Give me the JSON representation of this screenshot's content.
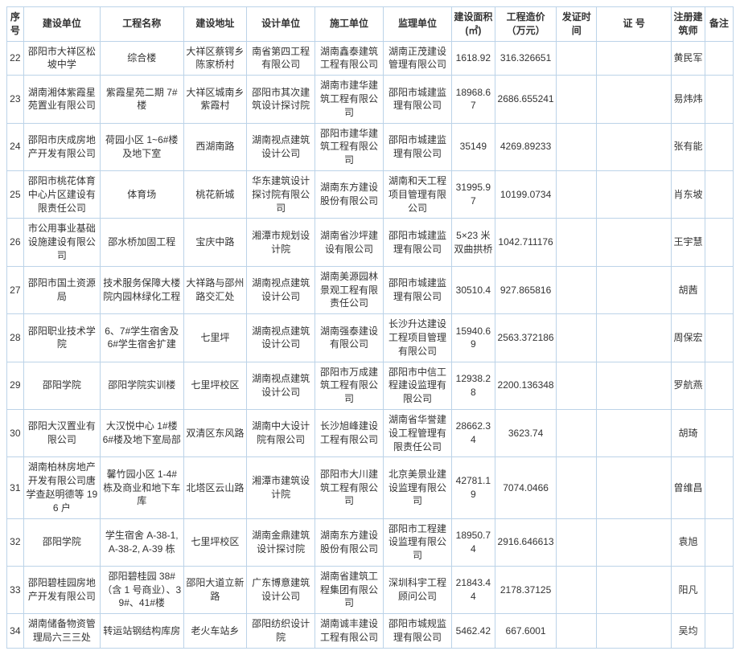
{
  "headers": {
    "seq": "序号",
    "unit": "建设单位",
    "proj": "工程名称",
    "addr": "建设地址",
    "designer": "设计单位",
    "contractor": "施工单位",
    "supervisor": "监理单位",
    "area": "建设面积(㎡)",
    "cost": "工程造价（万元）",
    "date": "发证时间",
    "cert": "证   号",
    "architect": "注册建筑师",
    "note": "备注"
  },
  "rows": [
    {
      "seq": "22",
      "unit": "邵阳市大祥区松坡中学",
      "proj": "综合楼",
      "addr": "大祥区蔡锷乡陈家桥村",
      "designer": "南省第四工程有限公司",
      "contractor": "湖南鑫泰建筑工程有限公司",
      "supervisor": "湖南正茂建设管理有限公司",
      "area": "1618.92",
      "cost": "316.326651",
      "date": "",
      "cert": "",
      "architect": "黄民军",
      "note": ""
    },
    {
      "seq": "23",
      "unit": "湖南湘体紫霞星苑置业有限公司",
      "proj": "紫霞星苑二期 7#楼",
      "addr": "大祥区城南乡紫霞村",
      "designer": "邵阳市其次建筑设计探讨院",
      "contractor": "湖南市建华建筑工程有限公司",
      "supervisor": "邵阳市城建监理有限公司",
      "area": "18968.67",
      "cost": "2686.655241",
      "date": "",
      "cert": "",
      "architect": "易炜炜",
      "note": ""
    },
    {
      "seq": "24",
      "unit": "邵阳市庆成房地产开发有限公司",
      "proj": "荷园小区 1~6#楼及地下室",
      "addr": "西湖南路",
      "designer": "湖南视点建筑设计公司",
      "contractor": "邵阳市建华建筑工程有限公司",
      "supervisor": "邵阳市城建监理有限公司",
      "area": "35149",
      "cost": "4269.89233",
      "date": "",
      "cert": "",
      "architect": "张有能",
      "note": ""
    },
    {
      "seq": "25",
      "unit": "邵阳市桃花体育中心片区建设有限责任公司",
      "proj": "体育场",
      "addr": "桃花新城",
      "designer": "华东建筑设计探讨院有限公司",
      "contractor": "湖南东方建设股份有限公司",
      "supervisor": "湖南和天工程项目管理有限公司",
      "area": "31995.97",
      "cost": "10199.0734",
      "date": "",
      "cert": "",
      "architect": "肖东坡",
      "note": ""
    },
    {
      "seq": "26",
      "unit": "市公用事业基础设施建设有限公司",
      "proj": "邵水桥加固工程",
      "addr": "宝庆中路",
      "designer": "湘潭市规划设计院",
      "contractor": "湖南省沙坪建设有限公司",
      "supervisor": "邵阳市城建监理有限公司",
      "area": "5×23 米双曲拱桥",
      "cost": "1042.711176",
      "date": "",
      "cert": "",
      "architect": "王宇慧",
      "note": ""
    },
    {
      "seq": "27",
      "unit": "邵阳市国土资源局",
      "proj": "技术服务保障大楼院内园林绿化工程",
      "addr": "大祥路与邵州路交汇处",
      "designer": "湖南视点建筑设计公司",
      "contractor": "湖南美源园林景观工程有限责任公司",
      "supervisor": "邵阳市城建监理有限公司",
      "area": "30510.4",
      "cost": "927.865816",
      "date": "",
      "cert": "",
      "architect": "胡茜",
      "note": ""
    },
    {
      "seq": "28",
      "unit": "邵阳职业技术学院",
      "proj": "6、7#学生宿舍及 6#学生宿舍扩建",
      "addr": "七里坪",
      "designer": "湖南视点建筑设计公司",
      "contractor": "湖南强泰建设有限公司",
      "supervisor": "长沙升达建设工程项目管理有限公司",
      "area": "15940.69",
      "cost": "2563.372186",
      "date": "",
      "cert": "",
      "architect": "周保宏",
      "note": ""
    },
    {
      "seq": "29",
      "unit": "邵阳学院",
      "proj": "邵阳学院实训楼",
      "addr": "七里坪校区",
      "designer": "湖南视点建筑设计公司",
      "contractor": "邵阳市万成建筑工程有限公司",
      "supervisor": "邵阳市中信工程建设监理有限公司",
      "area": "12938.28",
      "cost": "2200.136348",
      "date": "",
      "cert": "",
      "architect": "罗航燕",
      "note": ""
    },
    {
      "seq": "30",
      "unit": "邵阳大汉置业有限公司",
      "proj": "大汉悦中心 1#楼 6#楼及地下室局部",
      "addr": "双清区东风路",
      "designer": "湖南中大设计院有限公司",
      "contractor": "长沙旭峰建设工程有限公司",
      "supervisor": "湖南省华誉建设工程管理有限责任公司",
      "area": "28662.34",
      "cost": "3623.74",
      "date": "",
      "cert": "",
      "architect": "胡琦",
      "note": ""
    },
    {
      "seq": "31",
      "unit": "湖南柏林房地产开发有限公司唐学查赵明德等 196 户",
      "proj": "馨竹园小区 1-4#栋及商业和地下车库",
      "addr": "北塔区云山路",
      "designer": "湘潭市建筑设计院",
      "contractor": "邵阳市大川建筑工程有限公司",
      "supervisor": "北京美景业建设监理有限公司",
      "area": "42781.19",
      "cost": "7074.0466",
      "date": "",
      "cert": "",
      "architect": "曾维昌",
      "note": ""
    },
    {
      "seq": "32",
      "unit": "邵阳学院",
      "proj": "学生宿舍 A-38-1,A-38-2, A-39 栋",
      "addr": "七里坪校区",
      "designer": "湖南金鼎建筑设计探讨院",
      "contractor": "湖南东方建设股份有限公司",
      "supervisor": "邵阳市工程建设监理有限公司",
      "area": "18950.74",
      "cost": "2916.646613",
      "date": "",
      "cert": "",
      "architect": "袁旭",
      "note": ""
    },
    {
      "seq": "33",
      "unit": "邵阳碧桂园房地产开发有限公司",
      "proj": "邵阳碧桂园 38#（含 1 号商业）、39#、41#楼",
      "addr": "邵阳大道立新路",
      "designer": "广东博意建筑设计公司",
      "contractor": "湖南省建筑工程集团有限公司",
      "supervisor": "深圳科宇工程顾问公司",
      "area": "21843.44",
      "cost": "2178.37125",
      "date": "",
      "cert": "",
      "architect": "阳凡",
      "note": ""
    },
    {
      "seq": "34",
      "unit": "湖南储备物资管理局六三三处",
      "proj": "转运站钢结构库房",
      "addr": "老火车站乡",
      "designer": "邵阳纺织设计院",
      "contractor": "湖南诚丰建设工程有限公司",
      "supervisor": "邵阳市城规监理有限公司",
      "area": "5462.42",
      "cost": "667.6001",
      "date": "",
      "cert": "",
      "architect": "吴均",
      "note": ""
    }
  ]
}
